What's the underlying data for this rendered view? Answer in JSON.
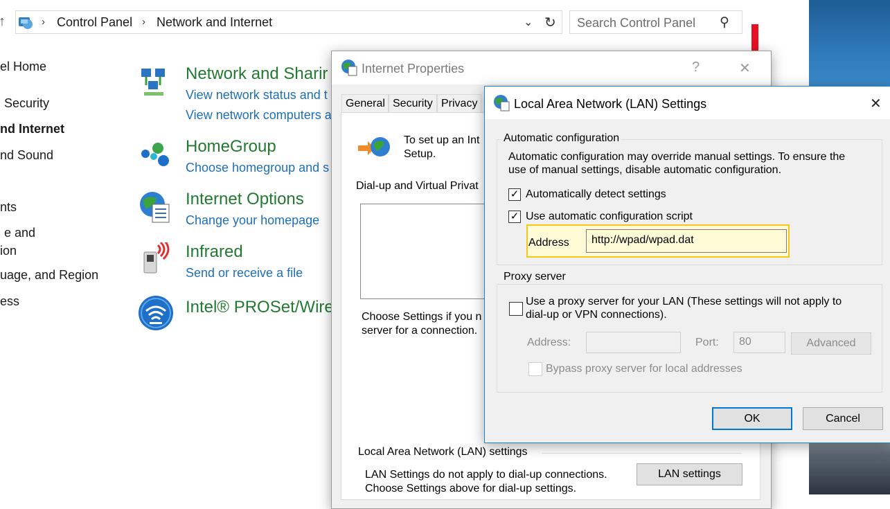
{
  "explorer": {
    "breadcrumb": [
      "Control Panel",
      "Network and Internet"
    ],
    "search_placeholder": "Search Control Panel",
    "nav": [
      "el Home",
      "Security",
      "nd Internet",
      "nd Sound",
      "nts",
      "e and",
      "ion",
      "uage, and Region",
      "ess"
    ],
    "categories": [
      {
        "title": "Network and Sharir",
        "links": [
          "View network status and t",
          "View network computers a"
        ]
      },
      {
        "title": "HomeGroup",
        "links": [
          "Choose homegroup and s"
        ]
      },
      {
        "title": "Internet Options",
        "links": [
          "Change your homepage"
        ]
      },
      {
        "title": "Infrared",
        "links": [
          "Send or receive a file"
        ]
      },
      {
        "title": "Intel® PROSet/Wire",
        "links": []
      }
    ]
  },
  "internet_properties": {
    "title": "Internet Properties",
    "help": "?",
    "close": "✕",
    "tabs": [
      "General",
      "Security",
      "Privacy"
    ],
    "setup_text_1": "To set up an Int",
    "setup_text_2": "Setup.",
    "dialup_label": "Dial-up and Virtual Privat",
    "choose_text_1": "Choose Settings if you n",
    "choose_text_2": "server for a connection.",
    "lan_group_label": "Local Area Network (LAN) settings",
    "lan_text_1": "LAN Settings do not apply to dial-up connections.",
    "lan_text_2": "Choose Settings above for dial-up settings.",
    "lan_button": "LAN settings"
  },
  "lan_dialog": {
    "title": "Local Area Network (LAN) Settings",
    "close": "✕",
    "auto_group": "Automatic configuration",
    "auto_desc_1": "Automatic configuration may override manual settings.  To ensure the",
    "auto_desc_2": "use of manual settings, disable automatic configuration.",
    "auto_detect": {
      "label": "Automatically detect settings",
      "checked": true
    },
    "auto_script": {
      "label": "Use automatic configuration script",
      "checked": true
    },
    "address_label": "Address",
    "address_value": "http://wpad/wpad.dat",
    "proxy_group": "Proxy server",
    "use_proxy": {
      "label_1": "Use a proxy server for your LAN (These settings will not apply to",
      "label_2": "dial-up or VPN connections).",
      "checked": false
    },
    "proxy_address_label": "Address:",
    "proxy_address_value": "",
    "port_label": "Port:",
    "port_value": "80",
    "advanced": "Advanced",
    "bypass": {
      "label": "Bypass proxy server for local addresses",
      "checked": false
    },
    "ok": "OK",
    "cancel": "Cancel"
  },
  "colors": {
    "link": "#1e6fb8",
    "category": "#217a2f",
    "highlight": "#f5c518",
    "address_bg": "#fffbd6",
    "accent": "#0078d7"
  }
}
